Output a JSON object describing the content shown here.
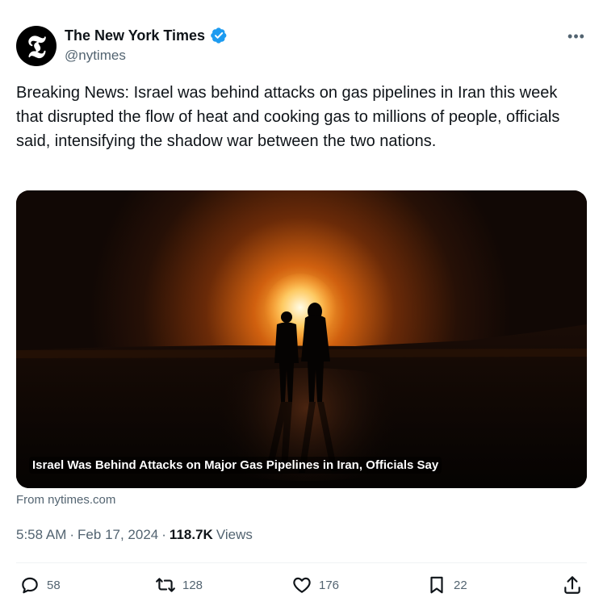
{
  "author": {
    "avatar_glyph": "𝕿",
    "display_name": "The New York Times",
    "handle": "@nytimes",
    "verified_icon": "verified-badge-icon",
    "verified_color": "#1d9bf0"
  },
  "tweet": {
    "text": "Breaking News: Israel was behind attacks on gas pipelines in Iran this week that disrupted the flow of heat and cooking gas to millions of people, officials said, intensifying the shadow war between the two nations."
  },
  "card": {
    "title": "Israel Was Behind Attacks on Major Gas Pipelines in Iran, Officials Say",
    "source": "From nytimes.com"
  },
  "meta": {
    "time": "5:58 AM",
    "separator": "·",
    "date": "Feb 17, 2024",
    "views_count": "118.7K",
    "views_label": "Views"
  },
  "actions": {
    "replies": "58",
    "retweets": "128",
    "likes": "176",
    "bookmarks": "22"
  },
  "colors": {
    "text_primary": "#0f1419",
    "text_secondary": "#536471",
    "accent": "#1d9bf0"
  }
}
